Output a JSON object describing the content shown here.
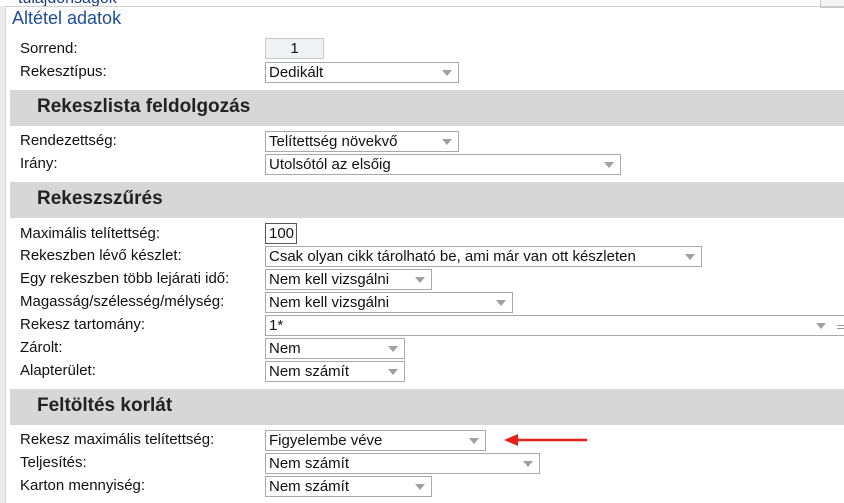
{
  "window": {
    "title": "Altétel adatok"
  },
  "clipped_header": {
    "text": "tulajdonságok"
  },
  "fields_top": {
    "sorrend": {
      "label": "Sorrend:",
      "value": "1"
    },
    "rekesztipus": {
      "label": "Rekesztípus:",
      "value": "Dedikált"
    }
  },
  "sections": {
    "rekeszlista": {
      "title": "Rekeszlista feldolgozás",
      "rendezettseg": {
        "label": "Rendezettség:",
        "value": "Telítettség növekvő"
      },
      "irany": {
        "label": "Irány:",
        "value": "Utolsótól az elsőig"
      }
    },
    "rekeszszures": {
      "title": "Rekeszszűrés",
      "max_telitettseg": {
        "label": "Maximális telítettség:",
        "value": "100"
      },
      "keszlet": {
        "label": "Rekeszben lévő készlet:",
        "value": "Csak olyan cikk tárolható be, ami már van ott készleten"
      },
      "lejarati_ido": {
        "label": "Egy rekeszben több lejárati idő:",
        "value": "Nem kell vizsgálni"
      },
      "meret": {
        "label": "Magasság/szélesség/mélység:",
        "value": "Nem kell vizsgálni"
      },
      "tartomany": {
        "label": "Rekesz tartomány:",
        "value": "1*"
      },
      "zarolt": {
        "label": "Zárolt:",
        "value": "Nem"
      },
      "alapterulet": {
        "label": "Alapterület:",
        "value": "Nem számít"
      }
    },
    "feltoltes": {
      "title": "Feltöltés korlát",
      "rekesz_max": {
        "label": "Rekesz maximális telítettség:",
        "value": "Figyelembe véve"
      },
      "teljesites": {
        "label": "Teljesítés:",
        "value": "Nem számít"
      },
      "karton": {
        "label": "Karton mennyiség:",
        "value": "Nem számít"
      }
    }
  },
  "annotation": {
    "arrow_color": "#e8201c"
  }
}
